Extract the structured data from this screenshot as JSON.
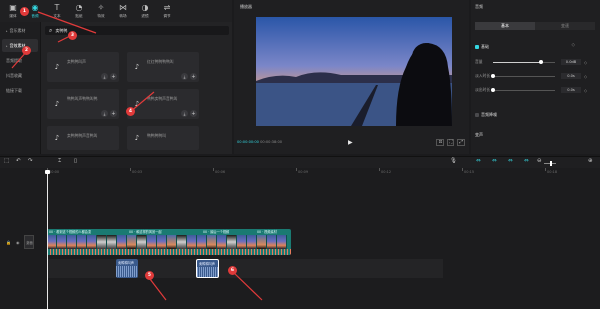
{
  "toolbar": {
    "items": [
      {
        "label": "媒体",
        "icon": "media-icon"
      },
      {
        "label": "音频",
        "icon": "audio-icon"
      },
      {
        "label": "文本",
        "icon": "text-icon"
      },
      {
        "label": "贴纸",
        "icon": "sticker-icon"
      },
      {
        "label": "特效",
        "icon": "effects-icon"
      },
      {
        "label": "转场",
        "icon": "transition-icon"
      },
      {
        "label": "滤镜",
        "icon": "filter-icon"
      },
      {
        "label": "调节",
        "icon": "adjust-icon"
      }
    ],
    "active_index": 1
  },
  "sidebar": {
    "items": [
      {
        "label": "音乐素材"
      },
      {
        "label": "音效素材"
      },
      {
        "label": "音频提取"
      },
      {
        "label": "抖音收藏"
      },
      {
        "label": "链接下载"
      }
    ],
    "active_index": 1
  },
  "search": {
    "value": "卖鸭鸭"
  },
  "media_cards": [
    {
      "name": "卖鸭鸭叫声"
    },
    {
      "name": "红红鸭鸭鸭鸭叫"
    },
    {
      "name": "鸭鸭叫声鸭鸭叫鸭"
    },
    {
      "name": "鸭鸭卖鸭声音鸭叫"
    },
    {
      "name": "卖鸭鸭鸭声音鸭叫"
    },
    {
      "name": "鸭鸭鸭鸭叫"
    }
  ],
  "player": {
    "title": "播放器",
    "time_current": "00:00:00:00",
    "time_total": "00:00:38:00",
    "controls": [
      "⊡",
      "⛶",
      "⤢"
    ]
  },
  "props": {
    "title": "音频",
    "tabs": [
      "基本",
      "变速"
    ],
    "active_tab": 0,
    "section_basic": "基础",
    "rows": [
      {
        "label": "音量",
        "value": "0.0dB",
        "fill": 0.78
      },
      {
        "label": "淡入时长",
        "value": "0.0s",
        "fill": 0.0
      },
      {
        "label": "淡出时长",
        "value": "0.0s",
        "fill": 0.0
      }
    ],
    "section_denoise": "音频降噪",
    "section_voice": "变声"
  },
  "timeline": {
    "ruler_labels": [
      "00:00",
      "00:03",
      "00:06",
      "00:09",
      "00:12",
      "00:15",
      "00:18"
    ],
    "track_cover_label": "封面",
    "clip_labels": [
      "00 · 看到这个视频的人都会变",
      "00 · 和这样的风景一起",
      "00 · 最后一个视频",
      "00 · 视频素材"
    ],
    "audio_clips": [
      {
        "label": "卖鸭鸭叫声"
      },
      {
        "label": "卖鸭鸭叫声"
      }
    ]
  },
  "annotations": [
    "1",
    "2",
    "3",
    "4",
    "5",
    "6"
  ],
  "colors": {
    "accent": "#34d7e0",
    "annotation": "#e03a3a"
  }
}
